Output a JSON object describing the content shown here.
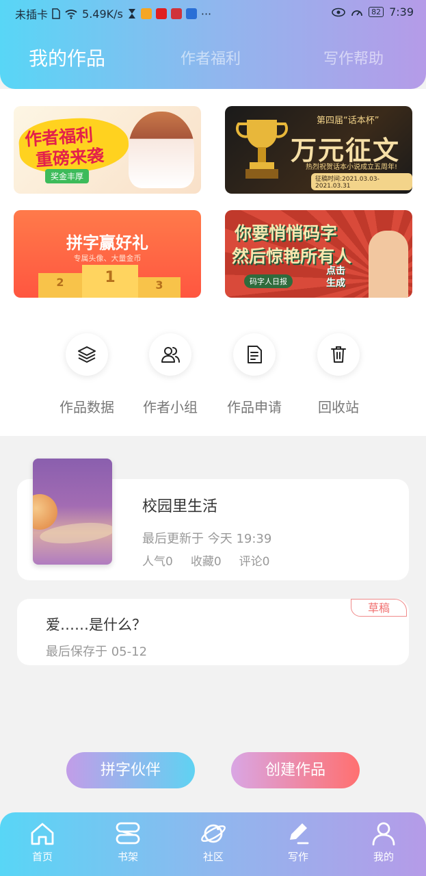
{
  "status_bar": {
    "carrier": "未插卡",
    "speed": "5.49K/s",
    "more": "···",
    "battery": "82",
    "time": "7:39"
  },
  "tabs": [
    {
      "label": "我的作品"
    },
    {
      "label": "作者福利"
    },
    {
      "label": "写作帮助"
    }
  ],
  "banners": [
    {
      "line1": "作者福利",
      "line2": "重磅来袭",
      "tag": "奖金丰厚"
    },
    {
      "top": "第四届“话本杯”",
      "main": "万元征文",
      "sub": "热烈祝贺话本小说成立五周年!",
      "date": "征稿时间:2021.03.03-2021.03.31"
    },
    {
      "main": "拼字赢好礼",
      "sub": "专属头像、大量金币",
      "podium": [
        "2",
        "1",
        "3"
      ]
    },
    {
      "line1": "你要悄悄码字",
      "line2": "然后惊艳所有人",
      "tag": "码字人日报",
      "cta": "点击生成"
    }
  ],
  "quick_actions": [
    {
      "label": "作品数据",
      "icon": "layers-icon"
    },
    {
      "label": "作者小组",
      "icon": "users-icon"
    },
    {
      "label": "作品申请",
      "icon": "document-icon"
    },
    {
      "label": "回收站",
      "icon": "trash-icon"
    }
  ],
  "work": {
    "title": "校园里生活",
    "updated": "最后更新于 今天 19:39",
    "popularity": "人气0",
    "favorites": "收藏0",
    "comments": "评论0"
  },
  "draft": {
    "title": "爱……是什么？",
    "saved": "最后保存于 05-12",
    "badge": "草稿"
  },
  "buttons": {
    "partner": "拼字伙伴",
    "create": "创建作品"
  },
  "bottom_nav": [
    {
      "label": "首页",
      "icon": "home-icon"
    },
    {
      "label": "书架",
      "icon": "bookshelf-icon"
    },
    {
      "label": "社区",
      "icon": "planet-icon"
    },
    {
      "label": "写作",
      "icon": "pen-icon"
    },
    {
      "label": "我的",
      "icon": "profile-icon"
    }
  ]
}
